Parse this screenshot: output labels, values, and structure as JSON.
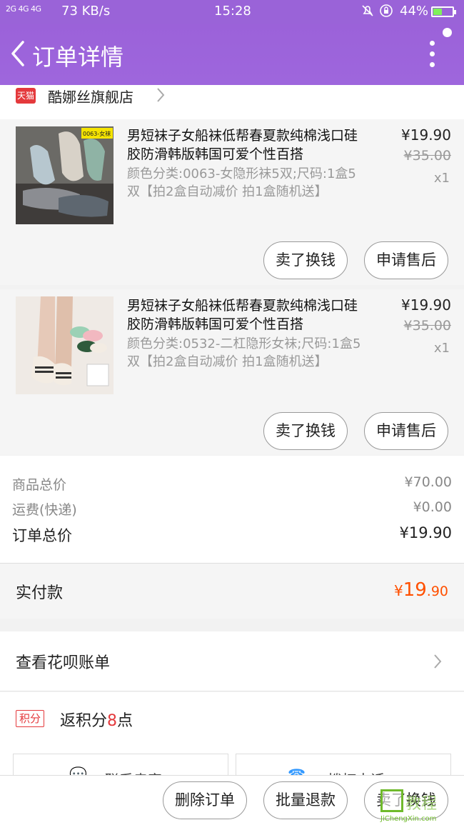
{
  "status_bar": {
    "signal": "2G 4G 4G",
    "speed": "73 KB/s",
    "time": "15:28",
    "battery": "44%",
    "battery_level": 0.44,
    "battery_color": "#7ff05a"
  },
  "header": {
    "title": "订单详情",
    "back_icon": "chevron-left-icon",
    "more_icon": "more-vertical-icon",
    "bg_color": "#9b62d9"
  },
  "shop": {
    "badge": "天猫",
    "name": "酷娜丝旗舰店"
  },
  "items": [
    {
      "title": "男短袜子女船袜低帮春夏款纯棉浅口硅胶防滑韩版韩国可爱个性百搭",
      "sku": "颜色分类:0063-女隐形袜5双;尺码:1盒5双【拍2盒自动减价 拍1盒随机送】",
      "price": "¥19.90",
      "orig_price": "¥35.00",
      "qty": "x1",
      "thumb_label": "0063-女袜",
      "btn_sell": "卖了换钱",
      "btn_after": "申请售后"
    },
    {
      "title": "男短袜子女船袜低帮春夏款纯棉浅口硅胶防滑韩版韩国可爱个性百搭",
      "sku": "颜色分类:0532-二杠隐形女袜;尺码:1盒5双【拍2盒自动减价 拍1盒随机送】",
      "price": "¥19.90",
      "orig_price": "¥35.00",
      "qty": "x1",
      "btn_sell": "卖了换钱",
      "btn_after": "申请售后"
    }
  ],
  "summary": {
    "goods_label": "商品总价",
    "goods_value": "¥70.00",
    "freight_label": "运费(快递)",
    "freight_value": "¥0.00",
    "total_label": "订单总价",
    "total_value": "¥19.90"
  },
  "paid": {
    "label": "实付款",
    "currency": "¥",
    "int": "19",
    "dec": ".90",
    "color": "#ff5000"
  },
  "huabei": {
    "label": "查看花呗账单"
  },
  "points": {
    "tag": "积分",
    "prefix": "返积分",
    "num": "8",
    "suffix": "点"
  },
  "contact": {
    "left_label": "联系卖家",
    "right_label": "拨打电话"
  },
  "bottom": {
    "delete": "删除订单",
    "refund": "批量退款",
    "sell": "卖了换钱"
  },
  "watermark": {
    "big": "教程",
    "small": "JiChengXin.com"
  }
}
